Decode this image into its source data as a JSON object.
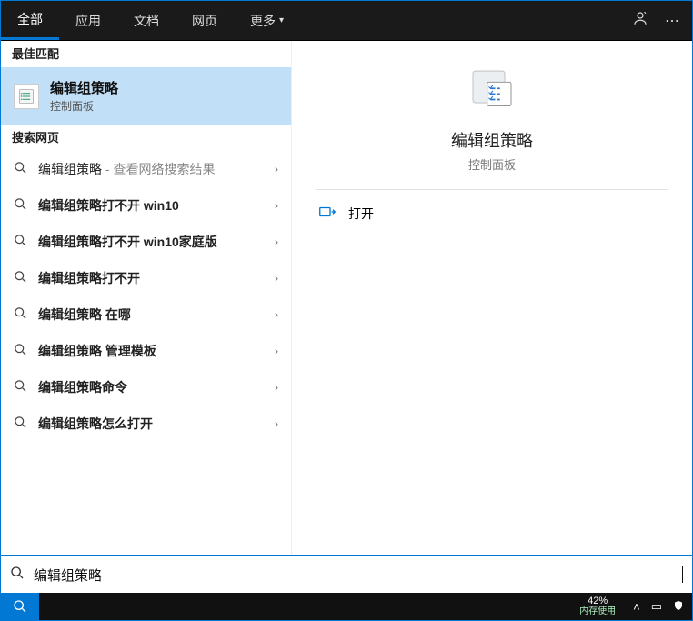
{
  "tabs": {
    "all": "全部",
    "apps": "应用",
    "docs": "文档",
    "web": "网页",
    "more": "更多"
  },
  "left": {
    "best_match_header": "最佳匹配",
    "best_match": {
      "title": "编辑组策略",
      "sub": "控制面板"
    },
    "search_web_header": "搜索网页",
    "results": [
      {
        "main": "编辑组策略",
        "sub": " - 查看网络搜索结果",
        "bold": false,
        "haschev": true
      },
      {
        "main": "编辑组策略打不开 win10",
        "sub": "",
        "bold": true,
        "haschev": true
      },
      {
        "main": "编辑组策略打不开 win10家庭版",
        "sub": "",
        "bold": true,
        "haschev": true
      },
      {
        "main": "编辑组策略打不开",
        "sub": "",
        "bold": true,
        "haschev": true
      },
      {
        "main": "编辑组策略 在哪",
        "sub": "",
        "bold": true,
        "haschev": true
      },
      {
        "main": "编辑组策略 管理模板",
        "sub": "",
        "bold": true,
        "haschev": true
      },
      {
        "main": "编辑组策略命令",
        "sub": "",
        "bold": true,
        "haschev": true
      },
      {
        "main": "编辑组策略怎么打开",
        "sub": "",
        "bold": true,
        "haschev": true
      }
    ]
  },
  "right": {
    "title": "编辑组策略",
    "sub": "控制面板",
    "open": "打开"
  },
  "search": {
    "value": "编辑组策略"
  },
  "taskbar": {
    "perf_pct": "42%",
    "perf_label": "内存使用"
  }
}
